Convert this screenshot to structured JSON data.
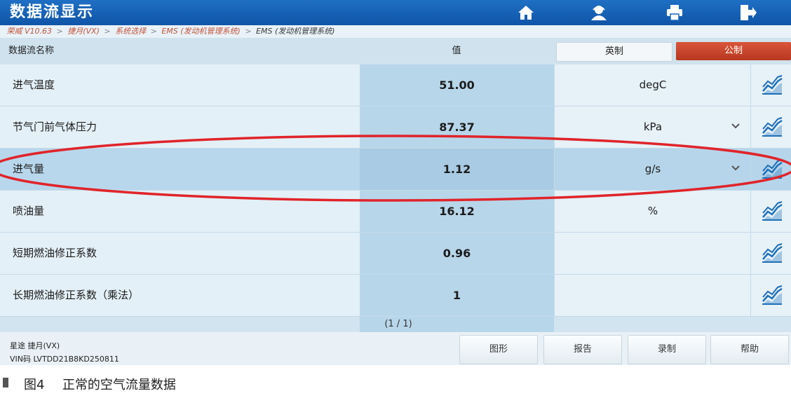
{
  "window": {
    "title": "数据流显示"
  },
  "toolbar": {
    "icons": [
      "home-icon",
      "user-icon",
      "print-icon",
      "exit-icon"
    ]
  },
  "breadcrumb": [
    "荣威 V10.63",
    "捷月(VX)",
    "系统选择",
    "EMS (发动机管理系统)",
    "EMS (发动机管理系统)"
  ],
  "breadcrumb_separator": ">",
  "table": {
    "header_name": "数据流名称",
    "header_value": "值",
    "unit_imperial": "英制",
    "unit_metric": "公制",
    "rows": [
      {
        "name": "进气温度",
        "value": "51.00",
        "unit": "degC",
        "has_dropdown": false
      },
      {
        "name": "节气门前气体压力",
        "value": "87.37",
        "unit": "kPa",
        "has_dropdown": true
      },
      {
        "name": "进气量",
        "value": "1.12",
        "unit": "g/s",
        "has_dropdown": true,
        "selected": true
      },
      {
        "name": "喷油量",
        "value": "16.12",
        "unit": "%",
        "has_dropdown": false
      },
      {
        "name": "短期燃油修正系数",
        "value": "0.96",
        "unit": "",
        "has_dropdown": false
      },
      {
        "name": "长期燃油修正系数（乘法）",
        "value": "1",
        "unit": "",
        "has_dropdown": false
      }
    ]
  },
  "pager": {
    "text": "(1 / 1)"
  },
  "footer": {
    "vehicle": "星途 捷月(VX)",
    "vin": "VIN码 LVTDD21B8KD250811",
    "buttons": [
      "图形",
      "报告",
      "录制",
      "帮助"
    ]
  },
  "caption": {
    "label": "图4",
    "text": "正常的空气流量数据"
  },
  "colors": {
    "title_bar": "#1565c0",
    "metric_button": "#c9432a",
    "value_column": "#b8d6ea",
    "annotation": "#e0242a",
    "chart_icon": "#1d6fb8"
  }
}
